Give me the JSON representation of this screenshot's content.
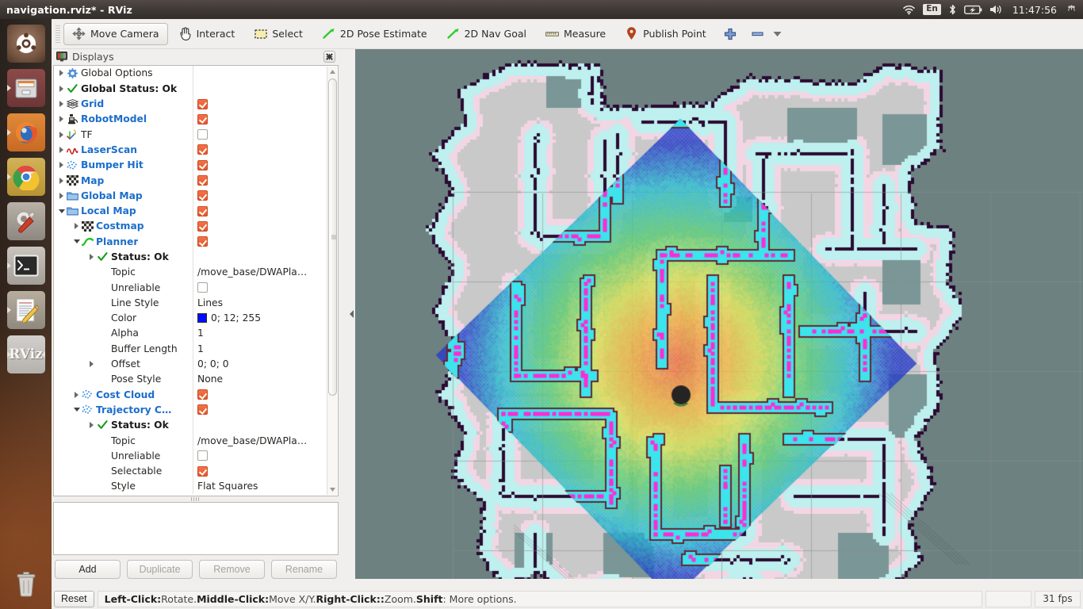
{
  "window": {
    "title": "navigation.rviz* - RViz"
  },
  "tray": {
    "wifi": "wifi-icon",
    "language": "En",
    "bluetooth": "bluetooth-icon",
    "battery": "battery-charging-icon",
    "volume": "volume-icon",
    "time": "11:47:56",
    "power": "power-gear-icon"
  },
  "launcher": {
    "items": [
      {
        "name": "ubuntu-dash",
        "glyph": "●"
      },
      {
        "name": "files",
        "glyph": "▤"
      },
      {
        "name": "firefox",
        "glyph": "●"
      },
      {
        "name": "chrome",
        "glyph": "●"
      },
      {
        "name": "settings",
        "glyph": "⚙"
      },
      {
        "name": "terminal",
        "glyph": ">_"
      },
      {
        "name": "text-editor",
        "glyph": "✎"
      },
      {
        "name": "rviz",
        "glyph": "RViz"
      }
    ]
  },
  "toolbar": {
    "buttons": [
      {
        "label": "Move Camera",
        "icon": "move-camera-icon",
        "checked": true
      },
      {
        "label": "Interact",
        "icon": "hand-pointer-icon",
        "checked": false
      },
      {
        "label": "Select",
        "icon": "selection-box-icon",
        "checked": false
      },
      {
        "label": "2D Pose Estimate",
        "icon": "pose-arrow-icon",
        "checked": false
      },
      {
        "label": "2D Nav Goal",
        "icon": "nav-goal-arrow-icon",
        "checked": false
      },
      {
        "label": "Measure",
        "icon": "ruler-icon",
        "checked": false
      },
      {
        "label": "Publish Point",
        "icon": "map-pin-icon",
        "checked": false
      }
    ],
    "add_tool_label": "+",
    "remove_tool_label": "−"
  },
  "displays_panel": {
    "title": "Displays",
    "close_label": "✖",
    "rows": [
      {
        "indent": 0,
        "arrow": "collapsed",
        "icon": "gear-icon",
        "label": "Global Options",
        "style": "plain",
        "value_type": "none"
      },
      {
        "indent": 0,
        "arrow": "collapsed",
        "icon": "check-icon",
        "label": "Global Status: Ok",
        "style": "bold-dark",
        "value_type": "none"
      },
      {
        "indent": 0,
        "arrow": "collapsed",
        "icon": "grid-icon",
        "label": "Grid",
        "style": "blue",
        "value_type": "checkbox",
        "checked": true
      },
      {
        "indent": 0,
        "arrow": "collapsed",
        "icon": "robot-icon",
        "label": "RobotModel",
        "style": "blue",
        "value_type": "checkbox",
        "checked": true
      },
      {
        "indent": 0,
        "arrow": "collapsed",
        "icon": "tf-axes-icon",
        "label": "TF",
        "style": "plain",
        "value_type": "checkbox",
        "checked": false
      },
      {
        "indent": 0,
        "arrow": "collapsed",
        "icon": "laserscan-icon",
        "label": "LaserScan",
        "style": "blue",
        "value_type": "checkbox",
        "checked": true
      },
      {
        "indent": 0,
        "arrow": "collapsed",
        "icon": "pointcloud-icon",
        "label": "Bumper Hit",
        "style": "blue",
        "value_type": "checkbox",
        "checked": true
      },
      {
        "indent": 0,
        "arrow": "collapsed",
        "icon": "map-icon",
        "label": "Map",
        "style": "blue",
        "value_type": "checkbox",
        "checked": true
      },
      {
        "indent": 0,
        "arrow": "collapsed",
        "icon": "folder-icon",
        "label": "Global Map",
        "style": "blue",
        "value_type": "checkbox",
        "checked": true
      },
      {
        "indent": 0,
        "arrow": "expanded",
        "icon": "folder-icon",
        "label": "Local Map",
        "style": "blue",
        "value_type": "checkbox",
        "checked": true
      },
      {
        "indent": 1,
        "arrow": "collapsed",
        "icon": "map-icon",
        "label": "Costmap",
        "style": "blue",
        "value_type": "checkbox",
        "checked": true
      },
      {
        "indent": 1,
        "arrow": "expanded",
        "icon": "path-icon",
        "label": "Planner",
        "style": "blue",
        "value_type": "checkbox",
        "checked": true
      },
      {
        "indent": 2,
        "arrow": "collapsed",
        "icon": "check-icon",
        "label": "Status: Ok",
        "style": "bold-dark",
        "value_type": "none"
      },
      {
        "indent": 2,
        "arrow": "none",
        "icon": "none",
        "label": "Topic",
        "style": "plain",
        "value_type": "text",
        "value": "/move_base/DWAPla…"
      },
      {
        "indent": 2,
        "arrow": "none",
        "icon": "none",
        "label": "Unreliable",
        "style": "plain",
        "value_type": "checkbox",
        "checked": false
      },
      {
        "indent": 2,
        "arrow": "none",
        "icon": "none",
        "label": "Line Style",
        "style": "plain",
        "value_type": "text",
        "value": "Lines"
      },
      {
        "indent": 2,
        "arrow": "none",
        "icon": "none",
        "label": "Color",
        "style": "plain",
        "value_type": "color",
        "value": "0; 12; 255",
        "swatch": "#000cff"
      },
      {
        "indent": 2,
        "arrow": "none",
        "icon": "none",
        "label": "Alpha",
        "style": "plain",
        "value_type": "text",
        "value": "1"
      },
      {
        "indent": 2,
        "arrow": "none",
        "icon": "none",
        "label": "Buffer Length",
        "style": "plain",
        "value_type": "text",
        "value": "1"
      },
      {
        "indent": 2,
        "arrow": "collapsed",
        "icon": "none",
        "label": "Offset",
        "style": "plain",
        "value_type": "text",
        "value": "0; 0; 0"
      },
      {
        "indent": 2,
        "arrow": "none",
        "icon": "none",
        "label": "Pose Style",
        "style": "plain",
        "value_type": "text",
        "value": "None"
      },
      {
        "indent": 1,
        "arrow": "collapsed",
        "icon": "pointcloud-icon",
        "label": "Cost Cloud",
        "style": "blue",
        "value_type": "checkbox",
        "checked": true
      },
      {
        "indent": 1,
        "arrow": "expanded",
        "icon": "pointcloud-icon",
        "label": "Trajectory C…",
        "style": "blue",
        "value_type": "checkbox",
        "checked": true
      },
      {
        "indent": 2,
        "arrow": "collapsed",
        "icon": "check-icon",
        "label": "Status: Ok",
        "style": "bold-dark",
        "value_type": "none"
      },
      {
        "indent": 2,
        "arrow": "none",
        "icon": "none",
        "label": "Topic",
        "style": "plain",
        "value_type": "text",
        "value": "/move_base/DWAPla…"
      },
      {
        "indent": 2,
        "arrow": "none",
        "icon": "none",
        "label": "Unreliable",
        "style": "plain",
        "value_type": "checkbox",
        "checked": false
      },
      {
        "indent": 2,
        "arrow": "none",
        "icon": "none",
        "label": "Selectable",
        "style": "plain",
        "value_type": "checkbox",
        "checked": true
      },
      {
        "indent": 2,
        "arrow": "none",
        "icon": "none",
        "label": "Style",
        "style": "plain",
        "value_type": "text",
        "value": "Flat Squares"
      }
    ],
    "buttons": [
      {
        "label": "Add",
        "enabled": true
      },
      {
        "label": "Duplicate",
        "enabled": false
      },
      {
        "label": "Remove",
        "enabled": false
      },
      {
        "label": "Rename",
        "enabled": false
      }
    ]
  },
  "statusbar": {
    "reset_label": "Reset",
    "hint_parts": [
      {
        "text": "Left-Click:",
        "bold": true
      },
      {
        "text": " Rotate. ",
        "bold": false
      },
      {
        "text": "Middle-Click:",
        "bold": true
      },
      {
        "text": " Move X/Y. ",
        "bold": false
      },
      {
        "text": "Right-Click::",
        "bold": true
      },
      {
        "text": " Zoom. ",
        "bold": false
      },
      {
        "text": "Shift",
        "bold": true
      },
      {
        "text": ": More options.",
        "bold": false
      }
    ],
    "fps": "31 fps"
  },
  "view3d": {
    "background_color": "#6d8181",
    "map_free_color": "#c9c9c9",
    "map_inflation_color": "#bdf0ee",
    "map_obstacle_color": "#2b0a33",
    "map_unknown_color": "#7b9696",
    "local_costmap_rotation_deg": 46,
    "robot_marker_color": "#262423"
  }
}
